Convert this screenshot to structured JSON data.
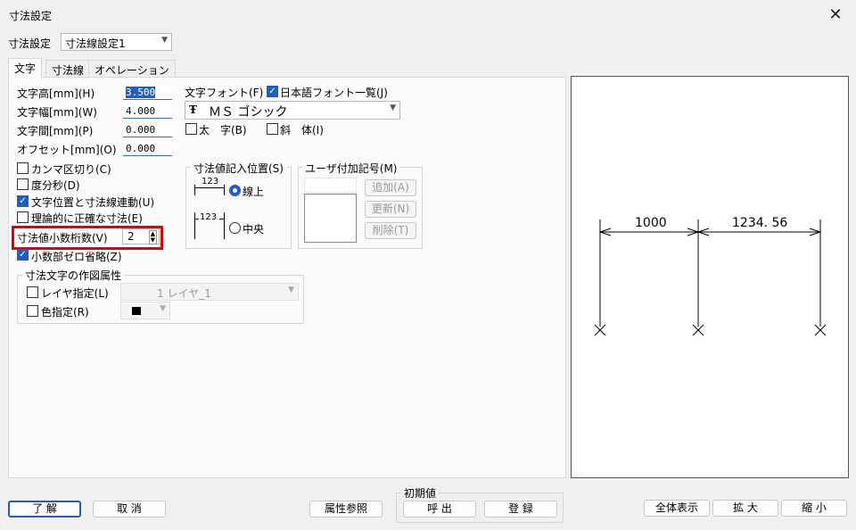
{
  "window": {
    "title": "寸法設定"
  },
  "preset": {
    "label": "寸法設定",
    "value": "寸法線設定1"
  },
  "tabs": [
    "文字",
    "寸法線",
    "オペレーション"
  ],
  "text_tab": {
    "fields": [
      {
        "label": "文字高[mm](H)",
        "value": "3.500"
      },
      {
        "label": "文字幅[mm](W)",
        "value": "4.000"
      },
      {
        "label": "文字間[mm](P)",
        "value": "0.000"
      },
      {
        "label": "オフセット[mm](O)",
        "value": "0.000"
      }
    ],
    "checks": [
      {
        "label": "カンマ区切り(C)",
        "checked": false
      },
      {
        "label": "度分秒(D)",
        "checked": false
      },
      {
        "label": "文字位置と寸法線連動(U)",
        "checked": true
      },
      {
        "label": "理論的に正確な寸法(E)",
        "checked": false
      }
    ],
    "decimal": {
      "label": "寸法値小数桁数(V)",
      "value": "2"
    },
    "zero_omit": {
      "label": "小数部ゼロ省略(Z)",
      "checked": true
    },
    "font_label": "文字フォント(F)",
    "jp_font_list": {
      "label": "日本語フォント一覧(J)",
      "checked": true
    },
    "font_value": "ＭＳ ゴシック",
    "font_icon": "Ŧ",
    "bold": {
      "label": "太　字(B)",
      "checked": false
    },
    "italic": {
      "label": "斜　体(I)",
      "checked": false
    },
    "position_group": {
      "title": "寸法値記入位置(S)",
      "sample": "123",
      "options": [
        {
          "label": "線上",
          "selected": true
        },
        {
          "label": "中央",
          "selected": false
        }
      ]
    },
    "user_symbol_group": {
      "title": "ユーザ付加記号(M)",
      "buttons": [
        "追加(A)",
        "更新(N)",
        "削除(T)"
      ]
    },
    "attr_group": {
      "title": "寸法文字の作図属性",
      "layer": {
        "label": "レイヤ指定(L)",
        "checked": false,
        "value": "1 レイヤ_1"
      },
      "color": {
        "label": "色指定(R)",
        "checked": false,
        "swatch": "#000000"
      }
    }
  },
  "preview": {
    "dim1": "1000",
    "dim2": "1234. 56"
  },
  "footer": {
    "ok": "了 解",
    "cancel": "取 消",
    "attr_ref": "属性参照",
    "init_group": "初期値",
    "recall": "呼 出",
    "register": "登 録",
    "show_all": "全体表示",
    "zoom_in": "拡 大",
    "zoom_out": "縮 小"
  }
}
